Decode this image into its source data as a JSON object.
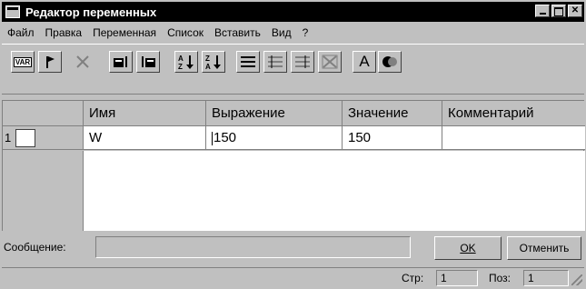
{
  "window": {
    "title": "Редактор переменных"
  },
  "menu": {
    "items": [
      {
        "label": "Файл"
      },
      {
        "label": "Правка"
      },
      {
        "label": "Переменная"
      },
      {
        "label": "Список"
      },
      {
        "label": "Вставить"
      },
      {
        "label": "Вид"
      },
      {
        "label": "?"
      }
    ]
  },
  "toolbar": {
    "buttons": [
      {
        "icon": "var-icon",
        "label": "VAR"
      },
      {
        "icon": "flag-icon"
      },
      {
        "icon": "delete-x-icon"
      },
      {
        "icon": "insert-before-icon"
      },
      {
        "icon": "insert-after-icon"
      },
      {
        "icon": "sort-ascending-icon"
      },
      {
        "icon": "sort-descending-icon"
      },
      {
        "icon": "align-left-icon"
      },
      {
        "icon": "align-lines-icon"
      },
      {
        "icon": "align-lines2-icon"
      },
      {
        "icon": "clear-icon"
      },
      {
        "icon": "font-icon",
        "label": "A"
      },
      {
        "icon": "color-icon"
      }
    ]
  },
  "grid": {
    "columns": [
      "Имя",
      "Выражение",
      "Значение",
      "Комментарий"
    ],
    "rows": [
      {
        "number": "1",
        "name": "W",
        "expression": "150",
        "value": "150",
        "comment": ""
      }
    ]
  },
  "message": {
    "label": "Сообщение:",
    "value": ""
  },
  "buttons": {
    "ok": "OK",
    "cancel": "Отменить"
  },
  "status": {
    "line_label": "Стр:",
    "line_value": "1",
    "pos_label": "Поз:",
    "pos_value": "1"
  }
}
